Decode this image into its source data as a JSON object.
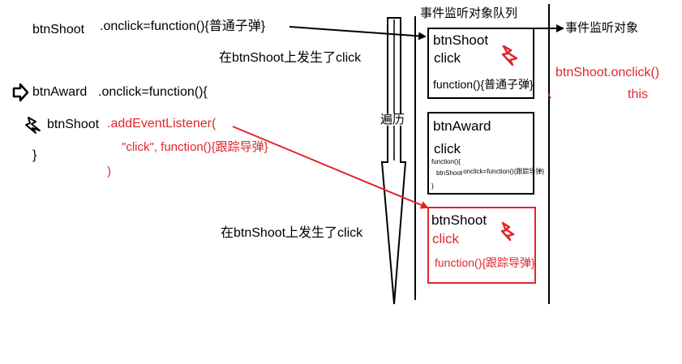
{
  "code": {
    "line1_obj": "btnShoot",
    "line1_rest": ".onclick=function(){普通子弹}",
    "line2_obj": "btnAward",
    "line2_rest": ".onclick=function(){",
    "line3_obj": "btnShoot",
    "line3_method": ".addEventListener(",
    "line4": "\"click\", function(){跟踪导弹}",
    "line5": ")",
    "line6": "}"
  },
  "annotations": {
    "click_event_1": "在btnShoot上发生了click",
    "click_event_2": "在btnShoot上发生了click",
    "traverse": "遍历",
    "listener_object": "事件监听对象",
    "onclick_expr": "btnShoot.onclick()",
    "this_label": "this"
  },
  "queue": {
    "title": "事件监听对象队列",
    "items": [
      {
        "target": "btnShoot",
        "event": "click",
        "handler": "function(){普通子弹}"
      },
      {
        "target": "btnAward",
        "event": "click",
        "handler_line1": "function(){",
        "handler_line2_obj": "btnShoot",
        "handler_line2_rest": ".onclick=function(){跟踪导弹}",
        "handler_line3": "}"
      },
      {
        "target": "btnShoot",
        "event": "click",
        "handler": "function(){跟踪导弹}"
      }
    ]
  },
  "colors": {
    "black": "#000000",
    "red": "#e0262c"
  },
  "icons": [
    "hollow-arrow-icon",
    "lightning-icon"
  ]
}
